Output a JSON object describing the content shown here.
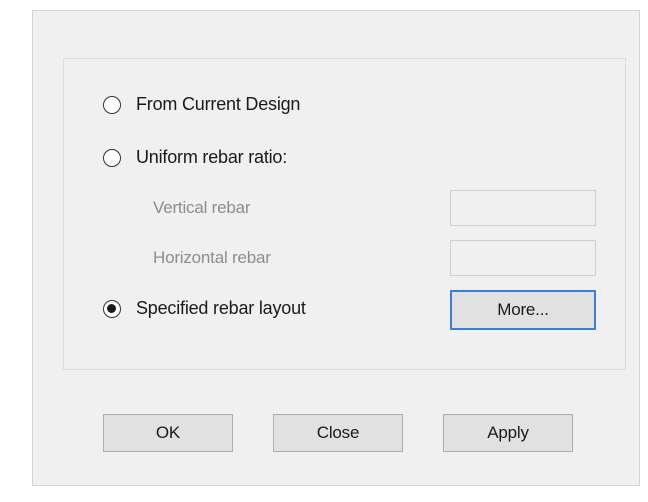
{
  "options": {
    "from_current_design": {
      "label": "From Current Design",
      "checked": false
    },
    "uniform_rebar_ratio": {
      "label": "Uniform rebar ratio:",
      "checked": false
    },
    "specified_rebar_layout": {
      "label": "Specified rebar layout",
      "checked": true
    }
  },
  "fields": {
    "vertical_rebar": {
      "label": "Vertical rebar",
      "value": ""
    },
    "horizontal_rebar": {
      "label": "Horizontal rebar",
      "value": ""
    }
  },
  "buttons": {
    "more": "More...",
    "ok": "OK",
    "close": "Close",
    "apply": "Apply"
  }
}
